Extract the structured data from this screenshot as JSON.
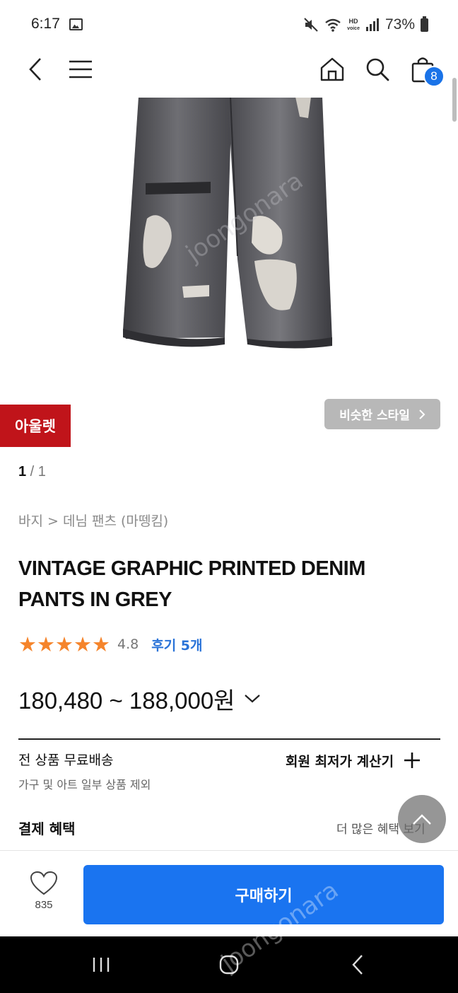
{
  "status_bar": {
    "time": "6:17",
    "hd_label": "HD",
    "voice_label": "voice",
    "battery_text": "73%"
  },
  "header": {
    "cart_count": "8"
  },
  "product": {
    "outlet_badge": "아울렛",
    "similar_style": "비슷한 스타일",
    "pager_current": "1",
    "pager_sep": " / ",
    "pager_total": "1",
    "breadcrumb": "바지 > 데님 팬츠 (마뗑킴)",
    "title": "VINTAGE GRAPHIC PRINTED DENIM PANTS IN GREY",
    "stars": "★★★★★",
    "rating": "4.8",
    "review_link": "후기 5개",
    "price": "180,480 ~ 188,000원",
    "image_watermark": "joongonara"
  },
  "shipping": {
    "title": "전 상품 무료배송",
    "subtitle": "가구 및 아트 일부 상품 제외",
    "calc_label": "회원 최저가 계산기"
  },
  "benefit": {
    "title": "결제 혜택",
    "more": "더 많은 혜택 보기"
  },
  "buy_bar": {
    "like_count": "835",
    "buy_label": "구매하기"
  },
  "overlay": {
    "watermark": "joongonara"
  },
  "colors": {
    "accent_blue": "#1a74f0",
    "outlet_red": "#c0141a",
    "star_orange": "#f5842b",
    "review_blue": "#2a73d8"
  }
}
